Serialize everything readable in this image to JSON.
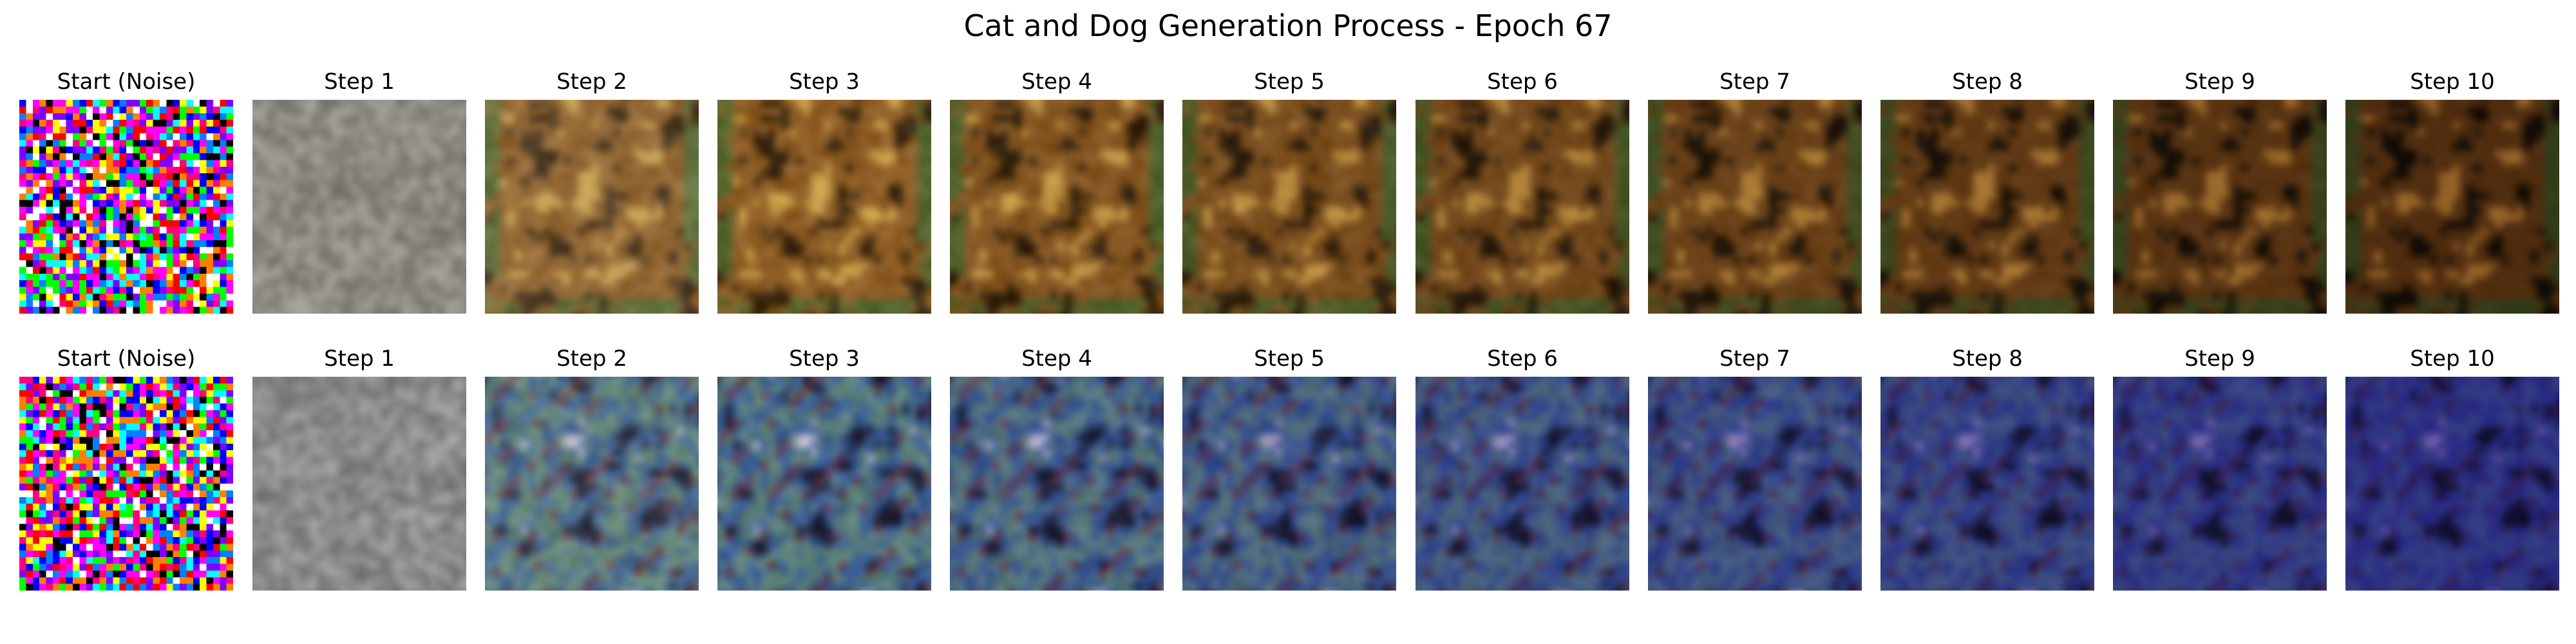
{
  "figure": {
    "title": "Cat and Dog Generation Process - Epoch 67"
  },
  "rows": [
    {
      "palette": "cat",
      "panels": [
        {
          "label": "Start (Noise)"
        },
        {
          "label": "Step 1"
        },
        {
          "label": "Step 2"
        },
        {
          "label": "Step 3"
        },
        {
          "label": "Step 4"
        },
        {
          "label": "Step 5"
        },
        {
          "label": "Step 6"
        },
        {
          "label": "Step 7"
        },
        {
          "label": "Step 8"
        },
        {
          "label": "Step 9"
        },
        {
          "label": "Step 10"
        }
      ]
    },
    {
      "palette": "dog",
      "panels": [
        {
          "label": "Start (Noise)"
        },
        {
          "label": "Step 1"
        },
        {
          "label": "Step 2"
        },
        {
          "label": "Step 3"
        },
        {
          "label": "Step 4"
        },
        {
          "label": "Step 5"
        },
        {
          "label": "Step 6"
        },
        {
          "label": "Step 7"
        },
        {
          "label": "Step 8"
        },
        {
          "label": "Step 9"
        },
        {
          "label": "Step 10"
        }
      ]
    }
  ]
}
